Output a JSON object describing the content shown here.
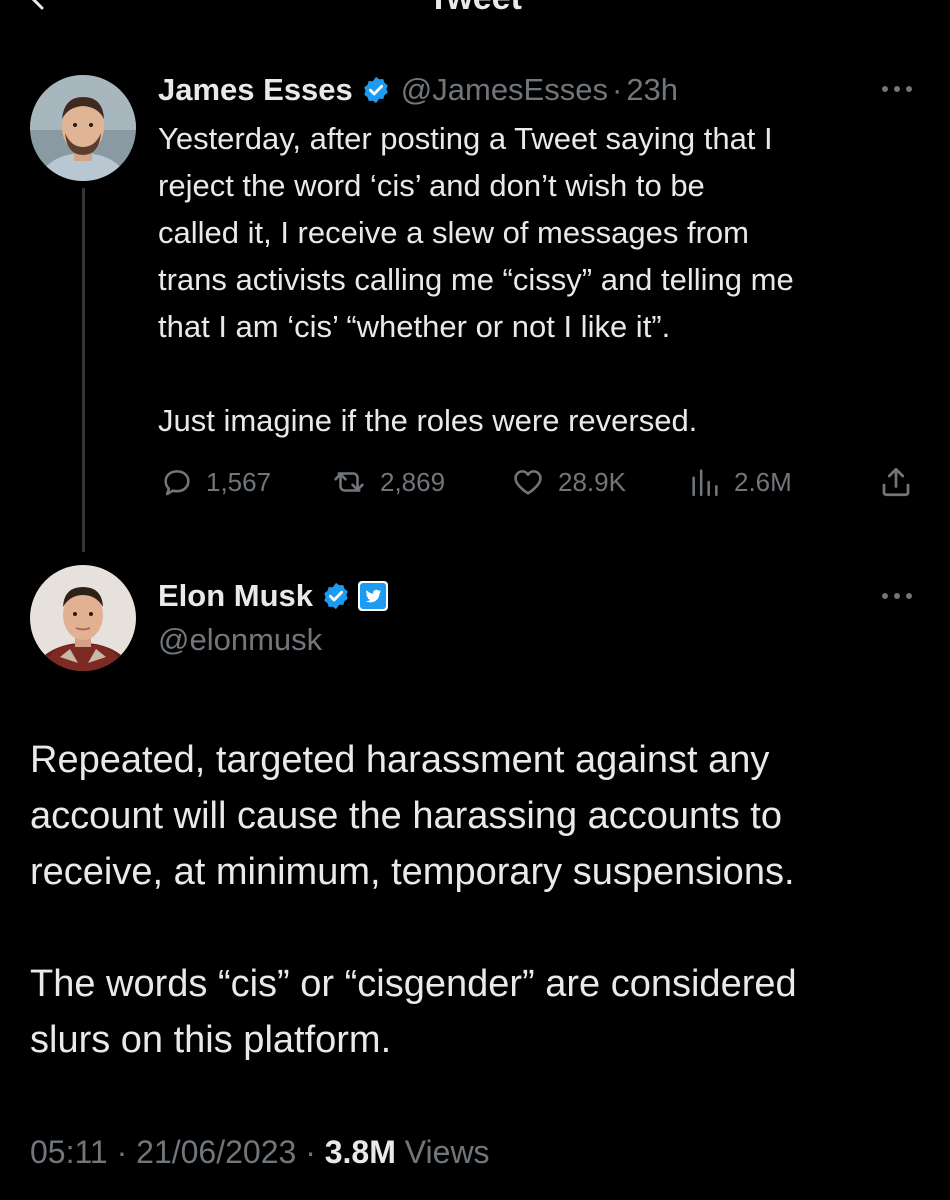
{
  "header": {
    "title": "Tweet"
  },
  "reply_to": {
    "name": "James Esses",
    "handle": "@JamesEsses",
    "separator": "·",
    "time": "23h",
    "text_lines": [
      "Yesterday, after posting a Tweet saying that I",
      "reject the word ‘cis’ and don’t wish to be",
      "called it, I receive a slew of messages from",
      "trans activists calling me “cissy” and telling me",
      "that I am ‘cis’ “whether or not I like it”."
    ],
    "text_last": "Just imagine if the roles were reversed.",
    "stats": {
      "replies": "1,567",
      "retweets": "2,869",
      "likes": "28.9K",
      "views": "2.6M"
    }
  },
  "main_tweet": {
    "name": "Elon Musk",
    "handle": "@elonmusk",
    "paragraph1_lines": [
      "Repeated, targeted harassment against any",
      "account will cause the harassing accounts to",
      "receive, at minimum, temporary suspensions."
    ],
    "paragraph2_lines": [
      "The words “cis” or “cisgender” are considered",
      "slurs on this platform."
    ],
    "time": "05:11",
    "sep1": "·",
    "date": "21/06/2023",
    "sep2": "·",
    "views_count": "3.8M",
    "views_label": "Views"
  },
  "colors": {
    "background": "#000000",
    "text": "#e7e9ea",
    "muted": "#71767b",
    "verified": "#1d9bf0",
    "thread_line": "#333639"
  },
  "icons": {
    "verified": "verified-badge-icon",
    "twitter_affiliate": "twitter-bird-icon",
    "reply": "reply-icon",
    "retweet": "retweet-icon",
    "like": "heart-icon",
    "views": "views-icon",
    "share": "share-icon",
    "more": "more-icon",
    "back": "back-arrow-icon"
  }
}
